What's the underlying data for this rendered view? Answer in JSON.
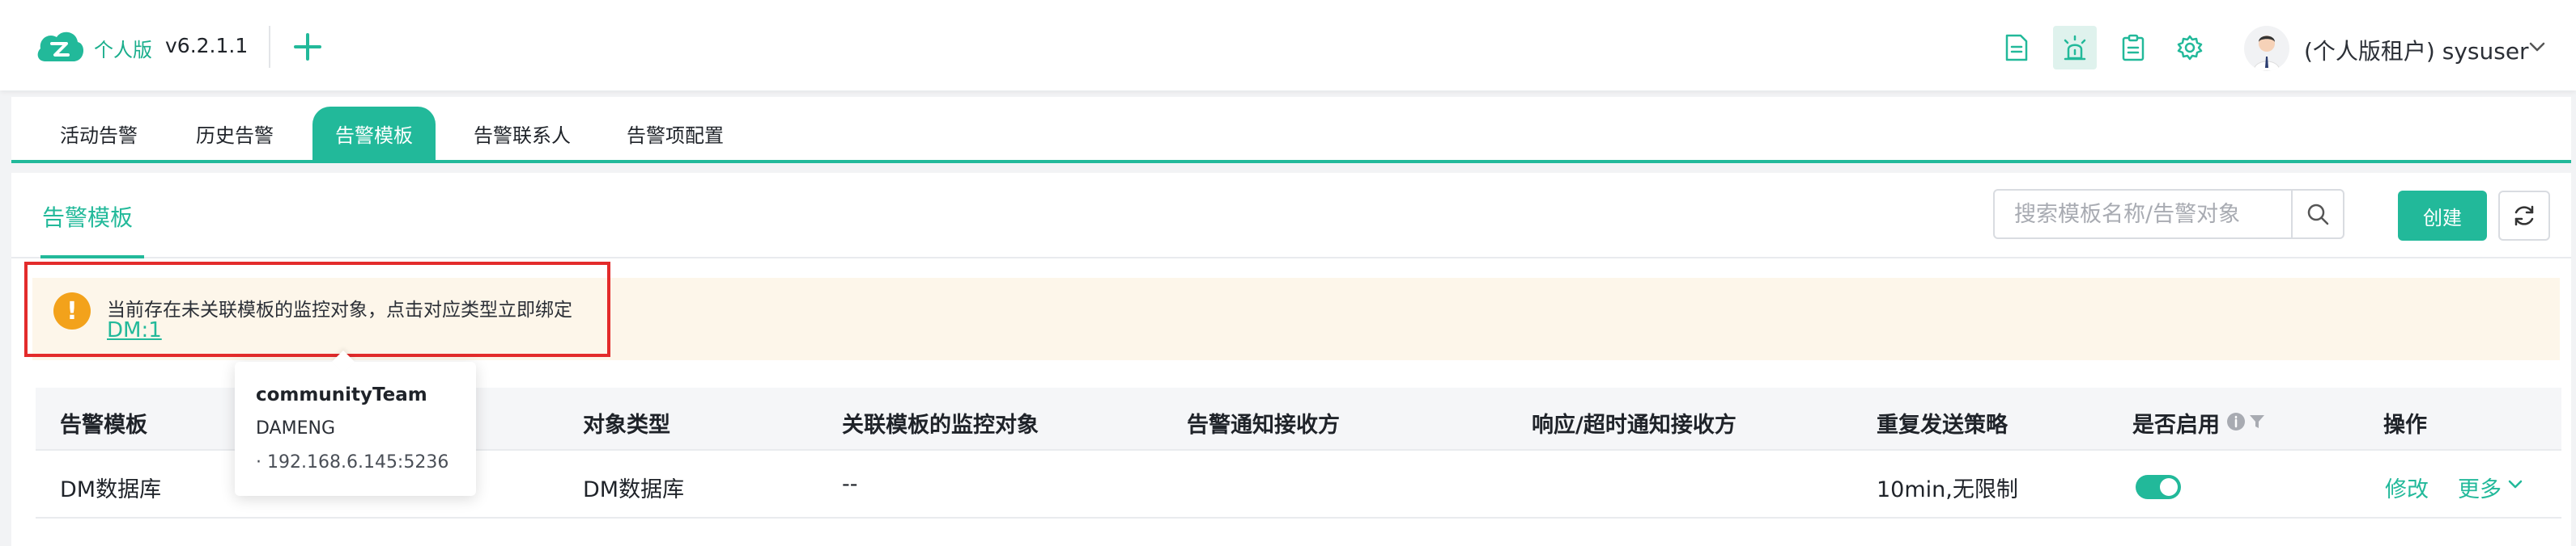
{
  "header": {
    "edition": "个人版",
    "version": "v6.2.1.1",
    "user_label": "(个人版租户) sysuser"
  },
  "tabs": [
    {
      "label": "活动告警",
      "active": false
    },
    {
      "label": "历史告警",
      "active": false
    },
    {
      "label": "告警模板",
      "active": true
    },
    {
      "label": "告警联系人",
      "active": false
    },
    {
      "label": "告警项配置",
      "active": false
    }
  ],
  "section": {
    "title": "告警模板",
    "search_placeholder": "搜索模板名称/告警对象",
    "create_label": "创建"
  },
  "warning": {
    "text": "当前存在未关联模板的监控对象，点击对应类型立即绑定",
    "link": "DM:1"
  },
  "table": {
    "headers": [
      "告警模板",
      "对象类型",
      "关联模板的监控对象",
      "告警通知接收方",
      "响应/超时通知接收方",
      "重复发送策略",
      "是否启用",
      "操作"
    ],
    "rows": [
      {
        "template": "DM数据库",
        "object_type": "DM数据库",
        "monitored_objects": "--",
        "notify": "",
        "timeout_notify": "",
        "repeat_policy": "10min,无限制",
        "enabled": true,
        "edit": "修改",
        "more": "更多"
      }
    ]
  },
  "popover": {
    "team": "communityTeam",
    "db": "DAMENG",
    "ip": "· 192.168.6.145:5236"
  },
  "colors": {
    "accent": "#22b99a",
    "warning": "#f3a21b",
    "highlight_border": "#e32b2b"
  }
}
